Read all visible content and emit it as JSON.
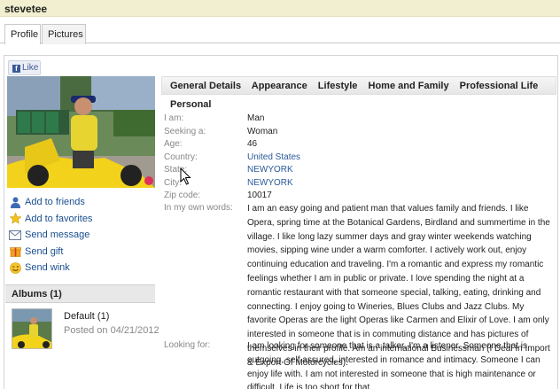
{
  "header": {
    "username": "stevetee"
  },
  "tabs": [
    {
      "label": "Profile",
      "active": true
    },
    {
      "label": "Pictures",
      "active": false
    }
  ],
  "fb_like": {
    "icon_letter": "f",
    "label": "Like"
  },
  "actions": [
    {
      "label": "Add to friends",
      "icon": "person-icon"
    },
    {
      "label": "Add to favorites",
      "icon": "star-icon"
    },
    {
      "label": "Send message",
      "icon": "envelope-icon"
    },
    {
      "label": "Send gift",
      "icon": "gift-icon"
    },
    {
      "label": "Send wink",
      "icon": "wink-smiley-icon"
    }
  ],
  "albums": {
    "header": "Albums (1)",
    "items": [
      {
        "title": "Default (1)",
        "date": "Posted on 04/21/2012"
      }
    ]
  },
  "profile_nav": [
    "General Details",
    "Appearance",
    "Lifestyle",
    "Home and Family",
    "Professional Life"
  ],
  "section_title": "Personal",
  "fields": [
    {
      "key": "I am:",
      "value": "Man",
      "link": false
    },
    {
      "key": "Seeking a:",
      "value": "Woman",
      "link": false
    },
    {
      "key": "Age:",
      "value": "46",
      "link": false
    },
    {
      "key": "Country:",
      "value": "United States",
      "link": true
    },
    {
      "key": "State:",
      "value": "NEWYORK",
      "link": true
    },
    {
      "key": "City:",
      "value": "NEWYORK",
      "link": true
    },
    {
      "key": "Zip code:",
      "value": "10017",
      "link": false
    }
  ],
  "own_words": {
    "key": "In my own words:",
    "value": "I am an easy going and patient man that values family and friends. I like Opera, spring time at the Botanical Gardens, Birdland and summertime in the village. I like long lazy summer days and gray winter weekends watching movies, sipping wine under a warm comforter. I actively work out, enjoy continuing education and traveling. I'm a romantic and express my romantic feelings whether I am in public or private. I love spending the night at a romantic restaurant with that someone special, talking, eating, drinking and connecting. I enjoy going to Wineries, Blues Clubs and Jazz Clubs. My favorite Operas are the light Operas like Carmen and Elixir of Love. I am only interested in someone that is in commuting distance and has pictures of themselves in their profile. Am an international Businessman (I Deal In Import & Export Of Motorcycles)."
  },
  "looking_for": {
    "key": "Looking for:",
    "value": "I am looking for someone that is a talker, I'm a listener. Someone that is outgoing, self assured, interested in romance and intimacy. Someone I can enjoy life with. I am not interested in someone that is high maintenance or difficult. Life is too short for that."
  },
  "colors": {
    "title_bar": "#f1efcf",
    "link": "#2a5a9a",
    "action_link": "#1a4f8f",
    "heart": "#e0305a"
  }
}
